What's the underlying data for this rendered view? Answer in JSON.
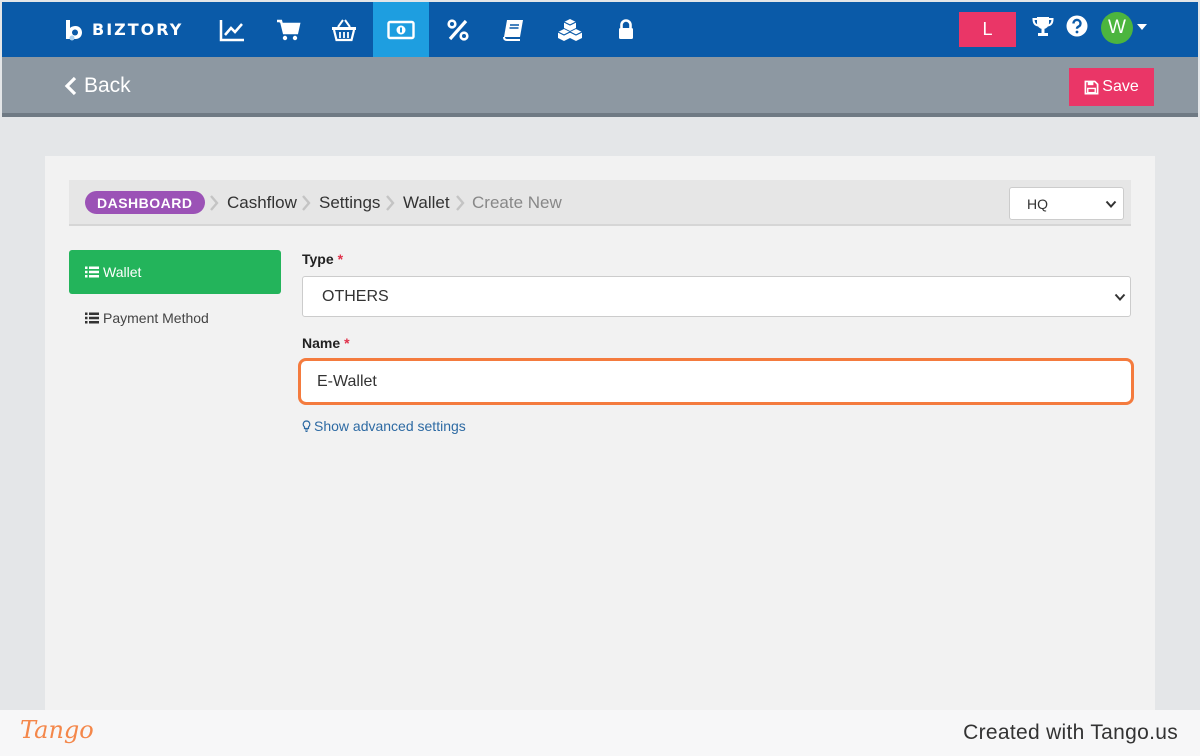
{
  "app": {
    "brand": "BIZTORY"
  },
  "navbar": {
    "icons": [
      "chart-line-icon",
      "cart-icon",
      "basket-icon",
      "money-icon",
      "percent-icon",
      "book-icon",
      "cubes-icon",
      "lock-icon"
    ],
    "active_icon": "money-icon",
    "location_badge": "L",
    "user_initial": "W",
    "colors": {
      "bar": "#0a5aa8",
      "active": "#1e9ee0",
      "badge": "#ea3667",
      "avatar": "#4cb53e"
    }
  },
  "toolbar": {
    "back_label": "Back",
    "save_label": "Save"
  },
  "breadcrumb": {
    "dashboard": "DASHBOARD",
    "items": [
      "Cashflow",
      "Settings",
      "Wallet",
      "Create New"
    ]
  },
  "branch_select": {
    "value": "HQ"
  },
  "sidebar": {
    "items": [
      {
        "label": "Wallet",
        "active": true
      },
      {
        "label": "Payment Method",
        "active": false
      }
    ]
  },
  "form": {
    "type": {
      "label": "Type",
      "required": "*",
      "value": "OTHERS"
    },
    "name": {
      "label": "Name",
      "required": "*",
      "value": "E-Wallet"
    },
    "advanced_link": "Show advanced settings"
  },
  "footer": {
    "logo": "Tango",
    "created_text": "Created with Tango.us"
  }
}
